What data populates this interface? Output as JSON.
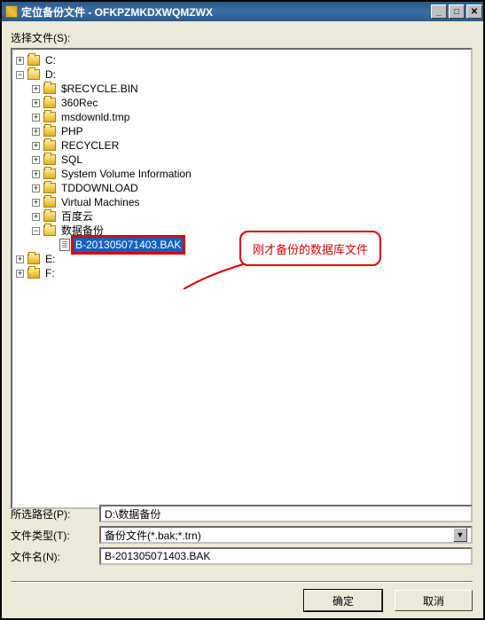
{
  "window": {
    "title": "定位备份文件 - OFKPZMKDXWQMZWX",
    "min": "_",
    "max": "□",
    "close": "✕"
  },
  "labels": {
    "select_file": "选择文件(S):",
    "path": "所选路径(P):",
    "filetype": "文件类型(T):",
    "filename": "文件名(N):"
  },
  "tree": {
    "c": "C:",
    "d": "D:",
    "items": [
      "$RECYCLE.BIN",
      "360Rec",
      "msdownld.tmp",
      "PHP",
      "RECYCLER",
      "SQL",
      "System Volume Information",
      "TDDOWNLOAD",
      "Virtual Machines",
      "百度云",
      "数据备份"
    ],
    "file": "B-201305071403.BAK",
    "e": "E:",
    "f": "F:"
  },
  "callout": "刚才备份的数据库文件",
  "form": {
    "path_value": "D:\\数据备份",
    "filetype_value": "备份文件(*.bak;*.trn)",
    "filename_value": "B-201305071403.BAK"
  },
  "buttons": {
    "ok": "确定",
    "cancel": "取消"
  }
}
